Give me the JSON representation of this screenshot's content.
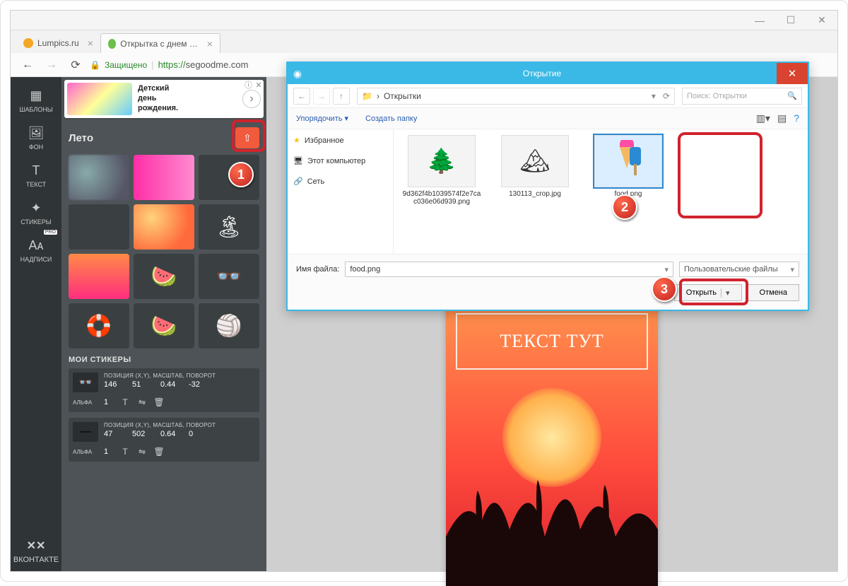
{
  "window": {
    "min": "—",
    "max": "☐",
    "close": "✕"
  },
  "tabs": [
    {
      "title": "Lumpics.ru",
      "favcolor": "#f5a623"
    },
    {
      "title": "Открытка с днем рожд...",
      "favcolor": "#6bbf4a"
    }
  ],
  "addressbar": {
    "secure_label": "Защищено",
    "url_prefix": "https://",
    "url_host": "segoodme.com"
  },
  "sidebar": {
    "items": [
      {
        "icon": "▦",
        "label": "ШАБЛОНЫ"
      },
      {
        "icon": "🖼",
        "label": "ФОН"
      },
      {
        "icon": "T",
        "label": "ТЕКСТ"
      },
      {
        "icon": "✦",
        "label": "СТИКЕРЫ"
      },
      {
        "icon": "Aᴀ",
        "label": "НАДПИСИ",
        "pro": "PRO"
      }
    ],
    "vk_label": "ВКОНТАКТЕ"
  },
  "panel": {
    "ad": {
      "line1": "Детский",
      "line2": "день",
      "line3": "рождения."
    },
    "category": "Лето",
    "upload_icon": "⇧",
    "my_stickers_title": "МОИ СТИКЕРЫ",
    "meta_label": "ПОЗИЦИЯ (X,Y), МАСШТАБ, ПОВОРОТ",
    "alpha_label": "АЛЬФА",
    "stickers": [
      {
        "id": 0,
        "x": "146",
        "y": "51",
        "scale": "0.44",
        "rot": "-32",
        "alpha": "1",
        "thumb": "👓"
      },
      {
        "id": 1,
        "x": "47",
        "y": "502",
        "scale": "0.64",
        "rot": "0",
        "alpha": "1",
        "thumb": "—"
      }
    ]
  },
  "poster": {
    "headline": "ТЕКСТ ТУТ"
  },
  "dialog": {
    "title": "Открытие",
    "breadcrumb": "Открытки",
    "search_placeholder": "Поиск: Открытки",
    "organize": "Упорядочить ▾",
    "new_folder": "Создать папку",
    "side": {
      "fav": "Избранное",
      "pc": "Этот компьютер",
      "net": "Сеть"
    },
    "files": [
      {
        "name": "9d362f4b1039574f2e7cac036e06d939.png",
        "selected": false
      },
      {
        "name": "130113_crop.jpg",
        "selected": false
      },
      {
        "name": "food.png",
        "selected": true
      }
    ],
    "filename_label": "Имя файла:",
    "filename_value": "food.png",
    "filter_label": "Пользовательские файлы",
    "open_btn": "Открыть",
    "cancel_btn": "Отмена"
  },
  "steps": {
    "one": "1",
    "two": "2",
    "three": "3"
  }
}
